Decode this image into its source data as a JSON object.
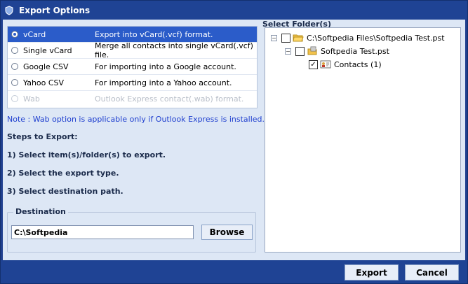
{
  "window": {
    "title": "Export Options"
  },
  "options": [
    {
      "name": "vCard",
      "description": "Export into vCard(.vcf) format.",
      "selected": true,
      "enabled": true
    },
    {
      "name": "Single vCard",
      "description": "Merge all contacts into single vCard(.vcf) file.",
      "selected": false,
      "enabled": true
    },
    {
      "name": "Google CSV",
      "description": "For importing into a Google account.",
      "selected": false,
      "enabled": true
    },
    {
      "name": "Yahoo CSV",
      "description": "For importing into a Yahoo account.",
      "selected": false,
      "enabled": true
    },
    {
      "name": "Wab",
      "description": "Outlook Express contact(.wab) format.",
      "selected": false,
      "enabled": false
    }
  ],
  "note": "Note : Wab option is applicable only if Outlook Express is installed.",
  "steps": {
    "heading": "Steps to Export:",
    "items": [
      "1) Select item(s)/folder(s) to export.",
      "2) Select the export type.",
      "3) Select destination path."
    ]
  },
  "destination": {
    "label": "Destination",
    "path": "C:\\Softpedia",
    "browse_label": "Browse"
  },
  "folders": {
    "label": "Select Folder(s)",
    "tree": {
      "root": {
        "label": "C:\\Softpedia Files\\Softpedia Test.pst",
        "expanded": true,
        "checked": false
      },
      "store": {
        "label": "Softpedia Test.pst",
        "expanded": true,
        "checked": false
      },
      "contacts": {
        "label": "Contacts (1)",
        "checked": true
      }
    }
  },
  "footer": {
    "export_label": "Export",
    "cancel_label": "Cancel"
  },
  "colors": {
    "title_bar": "#1f4394",
    "selected_row": "#2b5cc9",
    "note_text": "#1f3fcf",
    "client_background": "#dde7f5"
  }
}
